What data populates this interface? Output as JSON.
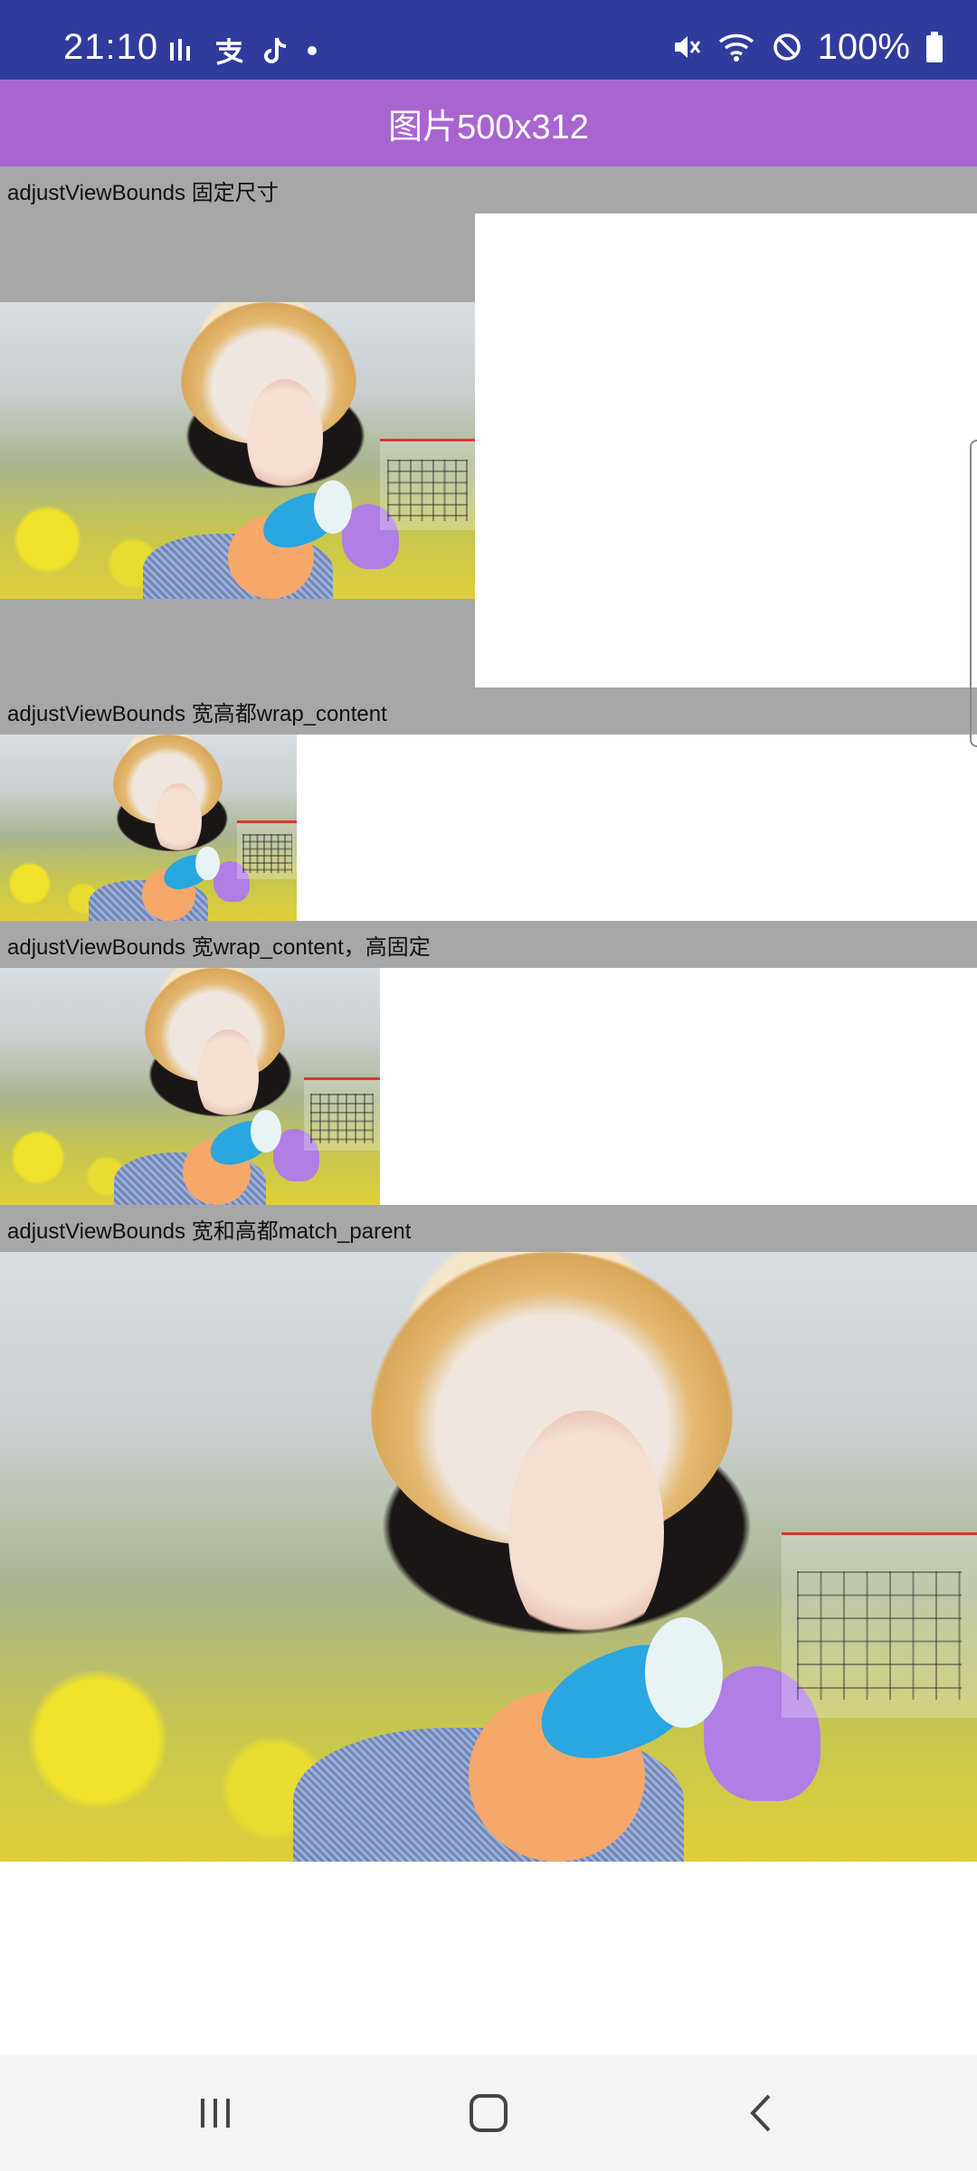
{
  "status_bar": {
    "time": "21:10",
    "battery_pct": "100%",
    "left_icons": [
      "audio-bars-icon",
      "alipay-icon",
      "tiktok-icon",
      "dot-icon"
    ],
    "right_icons": [
      "mute-icon",
      "wifi-icon",
      "blocked-icon",
      "battery-icon"
    ]
  },
  "app_bar": {
    "title": "图片500x312"
  },
  "sections": [
    {
      "label": "adjustViewBounds 固定尺寸"
    },
    {
      "label": "adjustViewBounds 宽高都wrap_content"
    },
    {
      "label": "adjustViewBounds 宽wrap_content，高固定"
    },
    {
      "label": "adjustViewBounds 宽和高都match_parent"
    }
  ],
  "nav_bar": {
    "buttons": [
      "recent-apps",
      "home",
      "back"
    ]
  },
  "colors": {
    "status_bar": "#2f3c9e",
    "app_bar": "#a865d0",
    "label_bar": "#a7a7a7",
    "nav_bar": "#f4f4f4"
  }
}
